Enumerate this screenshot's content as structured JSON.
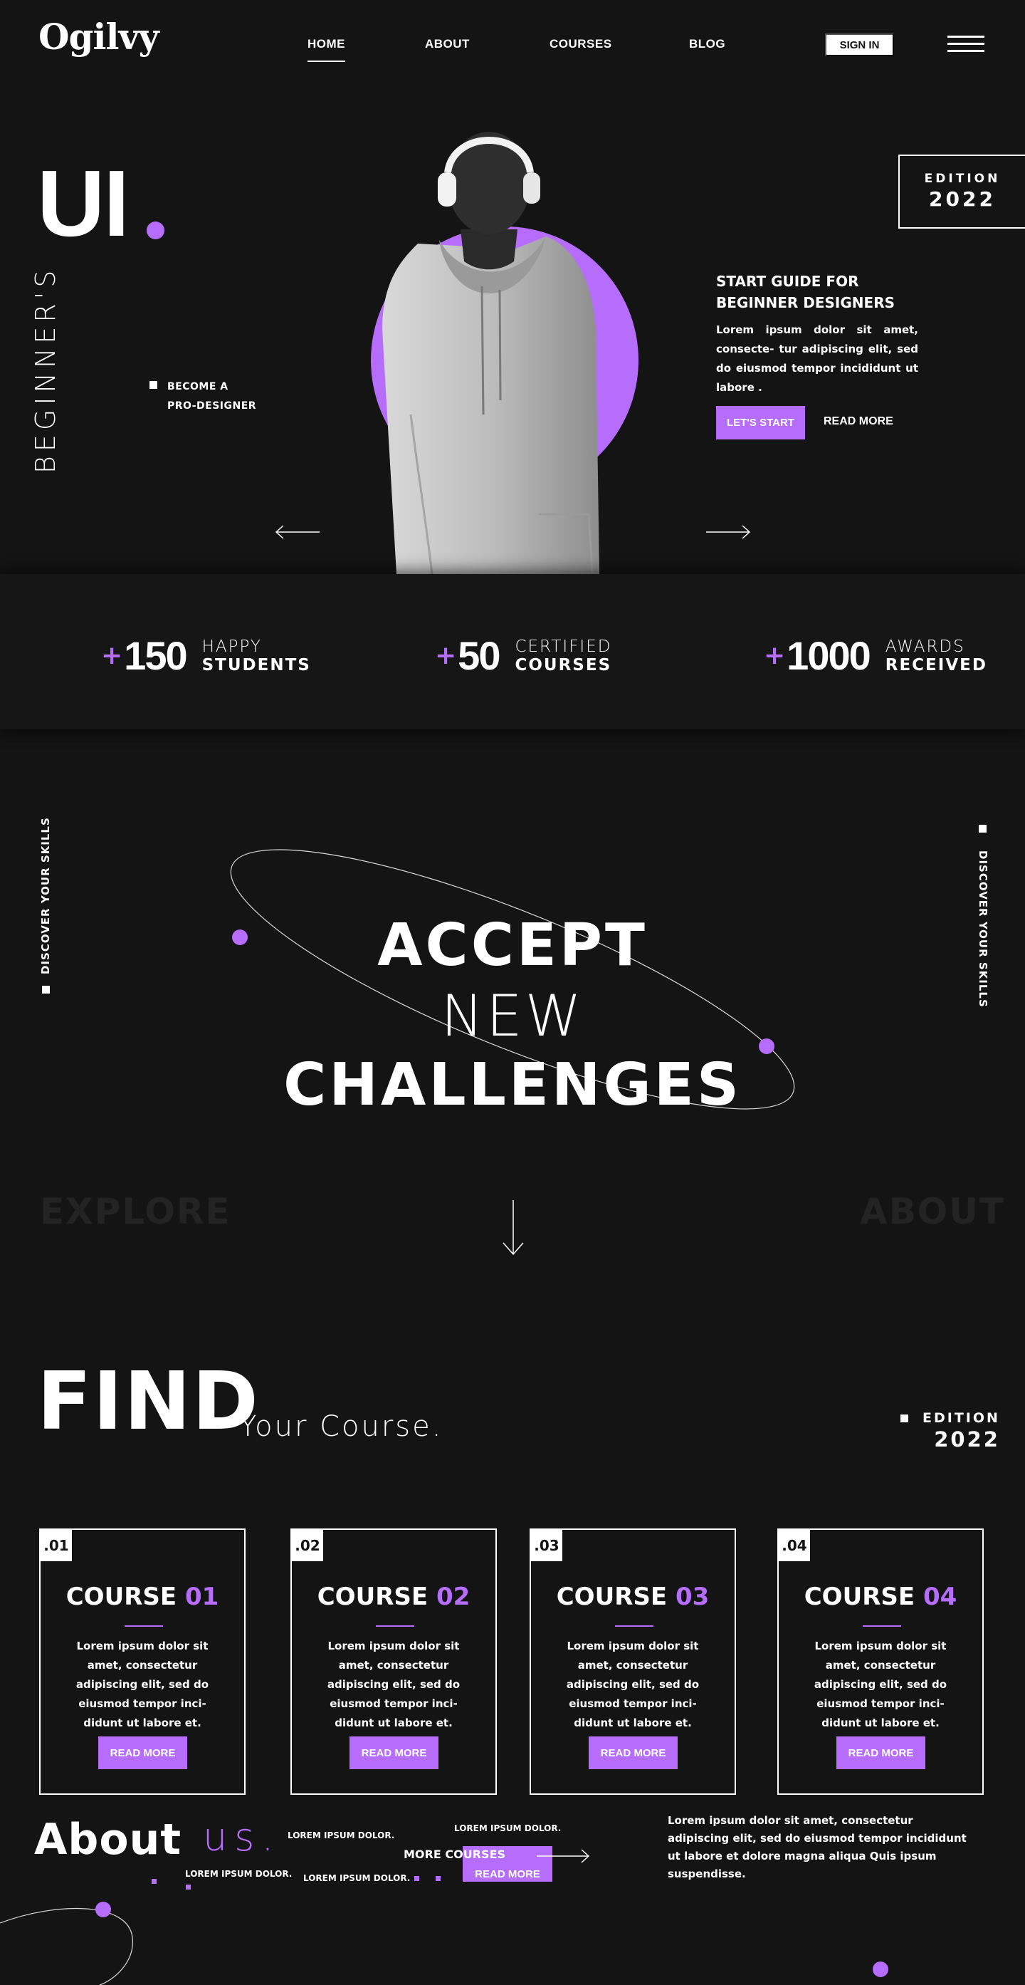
{
  "header": {
    "logo": "Ogilvy",
    "nav": [
      "HOME",
      "ABOUT",
      "COURSES",
      "BLOG"
    ],
    "signin": "SIGN IN"
  },
  "hero": {
    "title": "UI",
    "vertical": "BEGINNER'S",
    "bullet_line1": "BECOME A",
    "bullet_line2": "PRO-DESIGNER",
    "edition_label": "EDITION",
    "edition_year": "2022",
    "guide_title": "START GUIDE FOR BEGINNER DESIGNERS",
    "guide_text": "Lorem ipsum dolor sit amet, consecte- tur adipiscing elit, sed do eiusmod tempor incididunt ut labore .",
    "start_button": "LET'S START",
    "read_more": "READ MORE"
  },
  "stats": [
    {
      "plus": "+",
      "num": "150",
      "l1": "HAPPY",
      "l2": "STUDENTS"
    },
    {
      "plus": "+",
      "num": "50",
      "l1": "CERTIFIED",
      "l2": "COURSES"
    },
    {
      "plus": "+",
      "num": "1000",
      "l1": "AWARDS",
      "l2": "RECEIVED"
    }
  ],
  "challenge": {
    "side_text": "DISCOVER YOUR SKILLS",
    "line1": "ACCEPT",
    "line2": "NEW",
    "line3": "CHALLENGES",
    "ghost_left": "EXPLORE",
    "ghost_right": "ABOUT"
  },
  "courses": {
    "title": "FIND",
    "subtitle": "Your Course.",
    "edition_label": "EDITION",
    "edition_year": "2022",
    "items": [
      {
        "idx": ".01",
        "name": "COURSE",
        "num": "01",
        "desc": "Lorem ipsum dolor sit amet, consectetur adipiscing elit, sed do eiusmod tempor inci- didunt ut labore et.",
        "button": "READ MORE"
      },
      {
        "idx": ".02",
        "name": "COURSE",
        "num": "02",
        "desc": "Lorem ipsum dolor sit amet, consectetur adipiscing elit, sed do eiusmod tempor inci- didunt ut labore et.",
        "button": "READ MORE"
      },
      {
        "idx": ".03",
        "name": "COURSE",
        "num": "03",
        "desc": "Lorem ipsum dolor sit amet, consectetur adipiscing elit, sed do eiusmod tempor inci- didunt ut labore et.",
        "button": "READ MORE"
      },
      {
        "idx": ".04",
        "name": "COURSE",
        "num": "04",
        "desc": "Lorem ipsum dolor sit amet, consectetur adipiscing elit, sed do eiusmod tempor inci- didunt ut labore et.",
        "button": "READ MORE"
      }
    ]
  },
  "about": {
    "title": "About",
    "us": "us.",
    "tiny1": "LOREM IPSUM DOLOR.",
    "tiny2": "LOREM IPSUM DOLOR.",
    "tiny3": "LOREM IPSUM DOLOR.",
    "tiny4": "LOREM IPSUM DOLOR.",
    "more_courses": "MORE COURSES",
    "read_more": "READ MORE",
    "text": "Lorem ipsum dolor sit amet, consectetur adipiscing elit, sed do eiusmod tempor incididunt ut labore et dolore magna aliqua Quis ipsum suspendisse."
  },
  "colors": {
    "accent": "#b66dfb",
    "background": "#141414"
  }
}
